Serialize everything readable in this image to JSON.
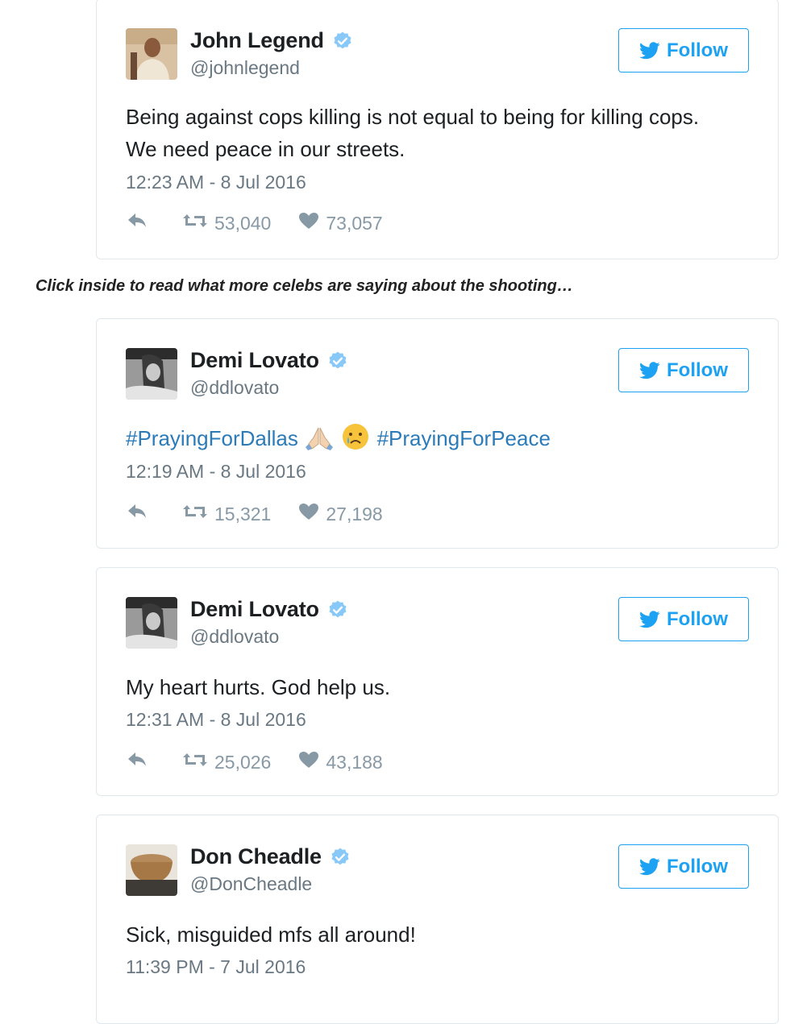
{
  "follow_label": "Follow",
  "colors": {
    "accent": "#1da1f2",
    "hashtag": "#2b7bb9",
    "muted": "#697882",
    "action": "#8899a6"
  },
  "tweets": [
    {
      "name": "John Legend",
      "handle": "@johnlegend",
      "text": "Being against cops killing is not equal to being for killing cops. We need peace in our streets.",
      "timestamp": "12:23 AM - 8 Jul 2016",
      "retweets": "53,040",
      "likes": "73,057"
    },
    {
      "name": "Demi Lovato",
      "handle": "@ddlovato",
      "hashtag1": "#PrayingForDallas",
      "hashtag2": "#PrayingForPeace",
      "emojis": [
        "folded-hands-emoji",
        "crying-face-emoji"
      ],
      "timestamp": "12:19 AM - 8 Jul 2016",
      "retweets": "15,321",
      "likes": "27,198"
    },
    {
      "name": "Demi Lovato",
      "handle": "@ddlovato",
      "text": "My heart hurts. God help us.",
      "timestamp": "12:31 AM - 8 Jul 2016",
      "retweets": "25,026",
      "likes": "43,188"
    },
    {
      "name": "Don Cheadle",
      "handle": "@DonCheadle",
      "text": "Sick, misguided mfs all around!",
      "timestamp": "11:39 PM - 7 Jul 2016"
    }
  ],
  "caption": "Click inside to read what more celebs are saying about the shooting…"
}
